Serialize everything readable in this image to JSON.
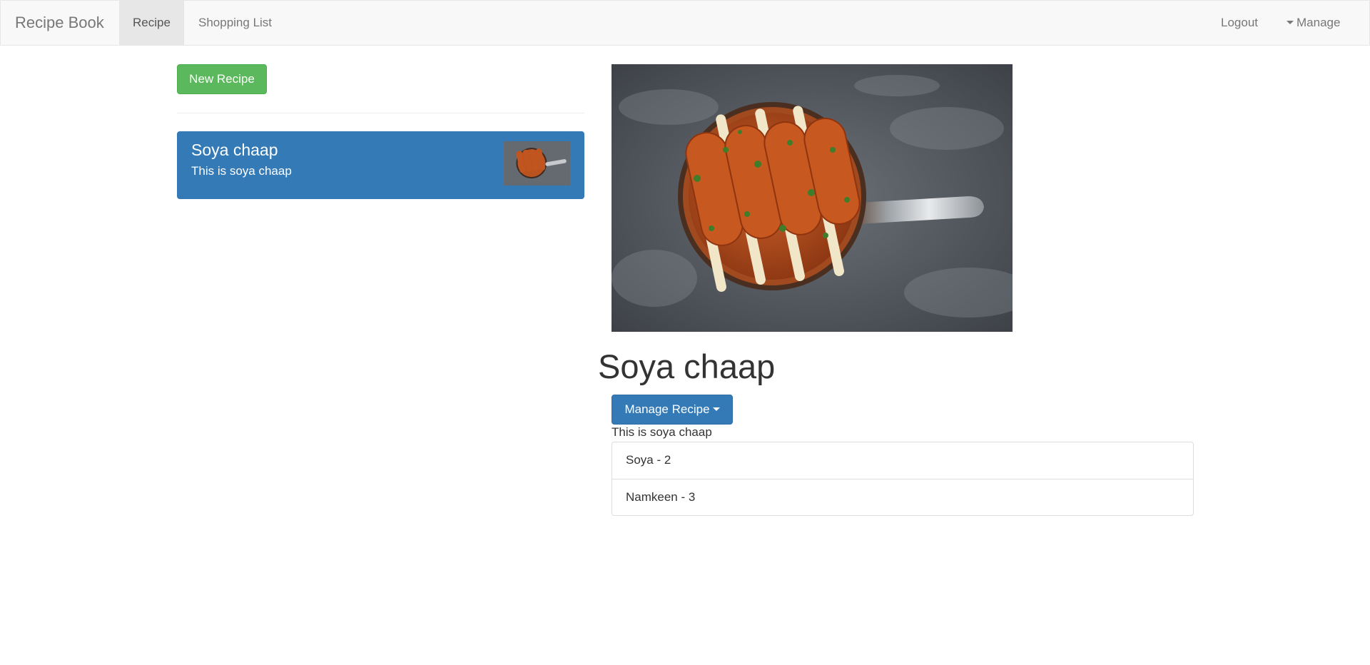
{
  "navbar": {
    "brand": "Recipe Book",
    "items": [
      {
        "label": "Recipe",
        "active": true
      },
      {
        "label": "Shopping List",
        "active": false
      }
    ],
    "right_items": [
      {
        "label": "Logout"
      },
      {
        "label": "Manage",
        "icon": "caret-down-icon"
      }
    ]
  },
  "sidebar": {
    "new_recipe_label": "New Recipe",
    "recipes": [
      {
        "name": "Soya chaap",
        "description": "This is soya chaap",
        "thumbnail": "soya-chaap-pan-image"
      }
    ]
  },
  "detail": {
    "image": "soya-chaap-pan-image",
    "title": "Soya chaap",
    "manage_button_label": "Manage Recipe",
    "description": "This is soya chaap",
    "ingredients": [
      {
        "text": "Soya - 2"
      },
      {
        "text": "Namkeen - 3"
      }
    ]
  },
  "colors": {
    "primary": "#337ab7",
    "success": "#5cb85c",
    "navbar_bg": "#f8f8f8",
    "active_nav_bg": "#e7e7e7"
  }
}
